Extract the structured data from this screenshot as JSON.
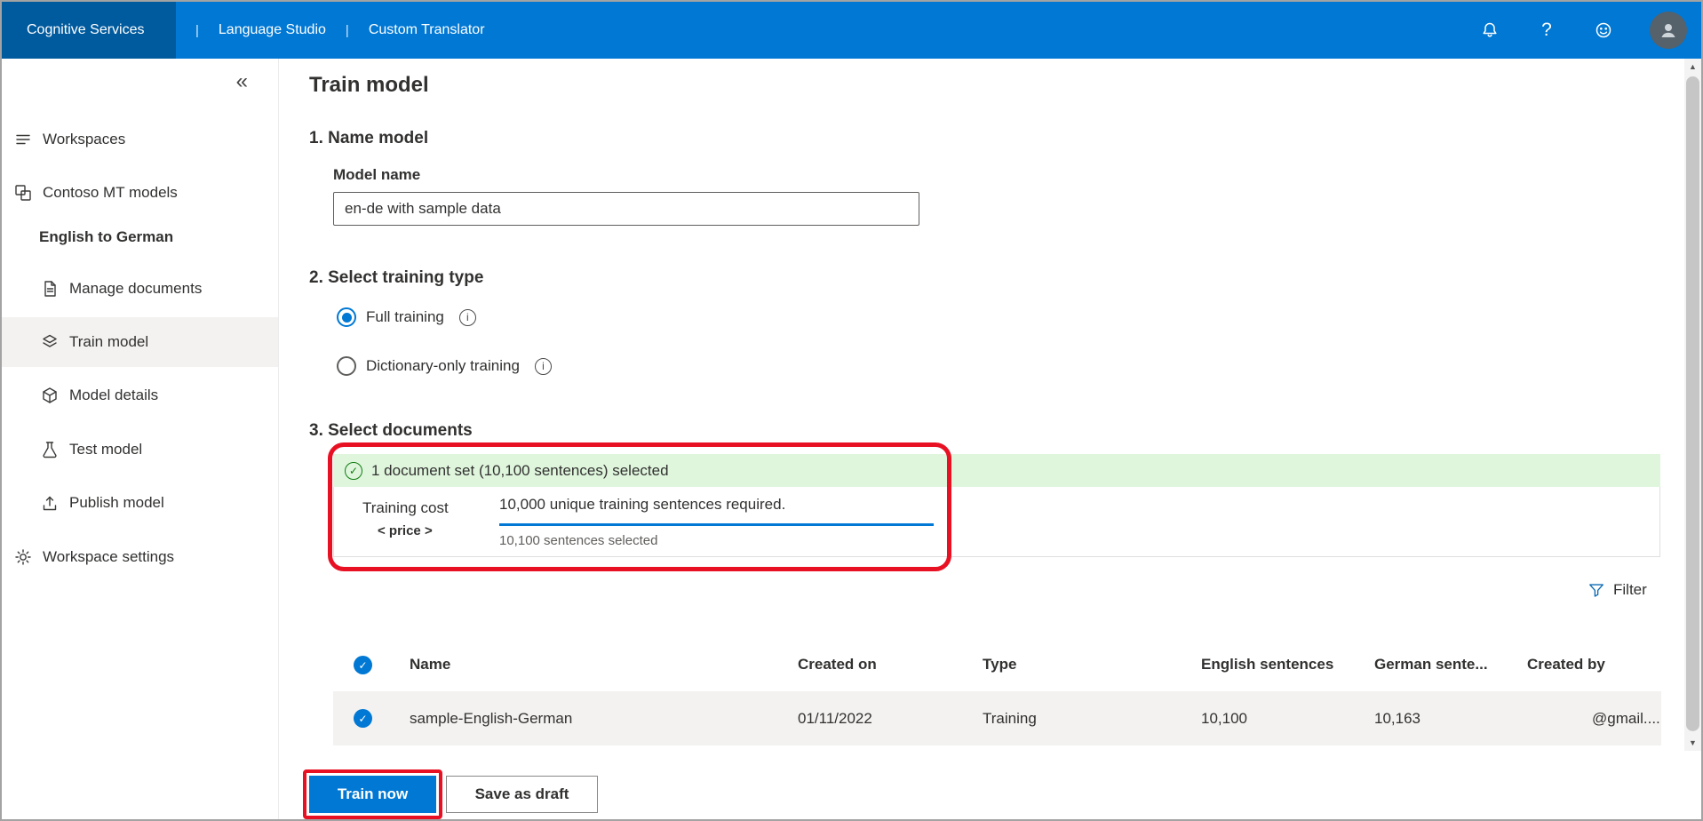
{
  "topbar": {
    "brand": "Cognitive Services",
    "separator": "|",
    "nav_items": [
      {
        "label": "Language Studio"
      },
      {
        "label": "Custom Translator"
      }
    ],
    "help_glyph": "?"
  },
  "sidebar": {
    "collapse": "«",
    "items": [
      {
        "label": "Workspaces"
      },
      {
        "label": "Contoso MT models"
      },
      {
        "label": "English to German"
      },
      {
        "label": "Manage documents"
      },
      {
        "label": "Train model"
      },
      {
        "label": "Model details"
      },
      {
        "label": "Test model"
      },
      {
        "label": "Publish model"
      },
      {
        "label": "Workspace settings"
      }
    ]
  },
  "main": {
    "title": "Train model",
    "name_model": {
      "heading": "1. Name model",
      "label": "Model name",
      "value": "en-de with sample data"
    },
    "training_type": {
      "heading": "2. Select training type",
      "option_full": "Full training",
      "option_dict": "Dictionary-only training",
      "info_glyph": "i"
    },
    "documents": {
      "heading": "3. Select documents",
      "banner": "1 document set (10,100 sentences) selected",
      "check_glyph": "✓",
      "cost_label": "Training cost",
      "cost_value": "< price >",
      "requirement": "10,000 unique training sentences required.",
      "selected_info": "10,100 sentences selected",
      "filter": "Filter"
    },
    "table": {
      "headers": {
        "name": "Name",
        "created_on": "Created on",
        "type": "Type",
        "english": "English sentences",
        "german": "German sente...",
        "created_by": "Created by"
      },
      "rows": [
        {
          "name": "sample-English-German",
          "created_on": "01/11/2022",
          "type": "Training",
          "english": "10,100",
          "german": "10,163",
          "created_by": "@gmail...."
        }
      ]
    },
    "actions": {
      "train": "Train now",
      "save_draft": "Save as draft"
    }
  },
  "scrollbar": {
    "up_glyph": "▲",
    "down_glyph": "▼"
  },
  "colors": {
    "topbar": "#0078d4",
    "brand_bg": "#005a9e",
    "accent": "#0078d4",
    "success_bg": "#dff6dd",
    "success_fg": "#107c10",
    "annotation_red": "#e81123",
    "row_bg": "#f3f2f1"
  }
}
